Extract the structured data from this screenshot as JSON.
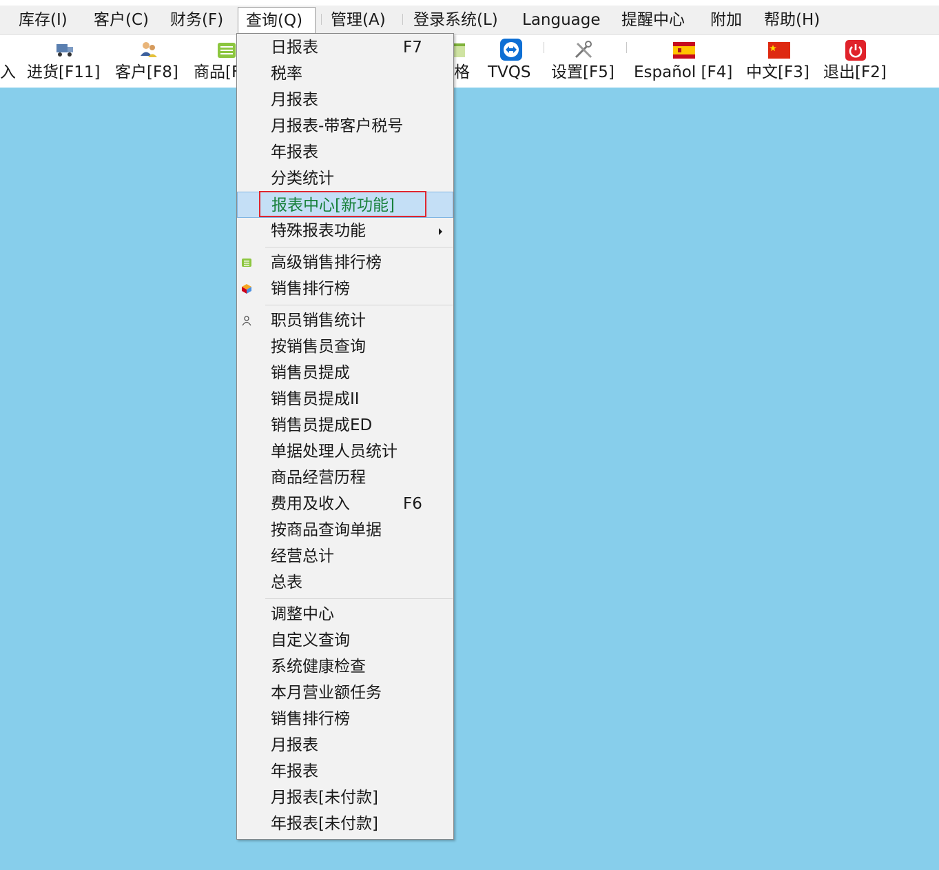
{
  "menubar": {
    "items": [
      {
        "label": "库存(I)"
      },
      {
        "label": "客户(C)"
      },
      {
        "label": "财务(F)"
      },
      {
        "label": "查询(Q)"
      },
      {
        "label": "管理(A)"
      },
      {
        "label": "登录系统(L)"
      },
      {
        "label": "Language"
      },
      {
        "label": "提醒中心"
      },
      {
        "label": "附加"
      },
      {
        "label": "帮助(H)"
      }
    ]
  },
  "toolbar": {
    "items": [
      {
        "label": "入",
        "icon": "none"
      },
      {
        "label": "进货[F11]",
        "icon": "truck-icon"
      },
      {
        "label": "客户[F8]",
        "icon": "users-icon"
      },
      {
        "label": "商品[F",
        "icon": "list-icon"
      },
      {
        "label": "格",
        "icon": "table-icon"
      },
      {
        "label": "TVQS",
        "icon": "teamviewer-icon"
      },
      {
        "label": "设置[F5]",
        "icon": "tools-icon"
      },
      {
        "label": "Español [F4]",
        "icon": "spain-flag-icon"
      },
      {
        "label": "中文[F3]",
        "icon": "china-flag-icon"
      },
      {
        "label": "退出[F2]",
        "icon": "power-icon"
      }
    ]
  },
  "dropdown": {
    "items": [
      {
        "label": "日报表",
        "shortcut": "F7"
      },
      {
        "label": "税率"
      },
      {
        "label": "月报表"
      },
      {
        "label": "月报表-带客户税号"
      },
      {
        "label": "年报表"
      },
      {
        "label": "分类统计"
      },
      {
        "label": "报表中心[新功能]",
        "highlighted": true
      },
      {
        "label": "特殊报表功能",
        "submenu": true
      },
      {
        "label": "高级销售排行榜",
        "icon": "list-icon"
      },
      {
        "label": "销售排行榜",
        "icon": "cube-icon"
      },
      {
        "label": "职员销售统计",
        "icon": "staff-icon"
      },
      {
        "label": "按销售员查询"
      },
      {
        "label": "销售员提成"
      },
      {
        "label": "销售员提成II"
      },
      {
        "label": "销售员提成ED"
      },
      {
        "label": "单据处理人员统计"
      },
      {
        "label": "商品经营历程"
      },
      {
        "label": "费用及收入",
        "shortcut": "F6"
      },
      {
        "label": "按商品查询单据"
      },
      {
        "label": "经营总计"
      },
      {
        "label": "总表"
      },
      {
        "label": "调整中心"
      },
      {
        "label": "自定义查询"
      },
      {
        "label": "系统健康检查"
      },
      {
        "label": "本月营业额任务"
      },
      {
        "label": "销售排行榜"
      },
      {
        "label": "月报表"
      },
      {
        "label": "年报表"
      },
      {
        "label": "月报表[未付款]"
      },
      {
        "label": "年报表[未付款]"
      }
    ]
  },
  "colors": {
    "desktop": "#87CEEB",
    "menu_highlight": "#c4dff6",
    "highlight_text": "#17803a",
    "annotation_red": "#e0262f"
  }
}
